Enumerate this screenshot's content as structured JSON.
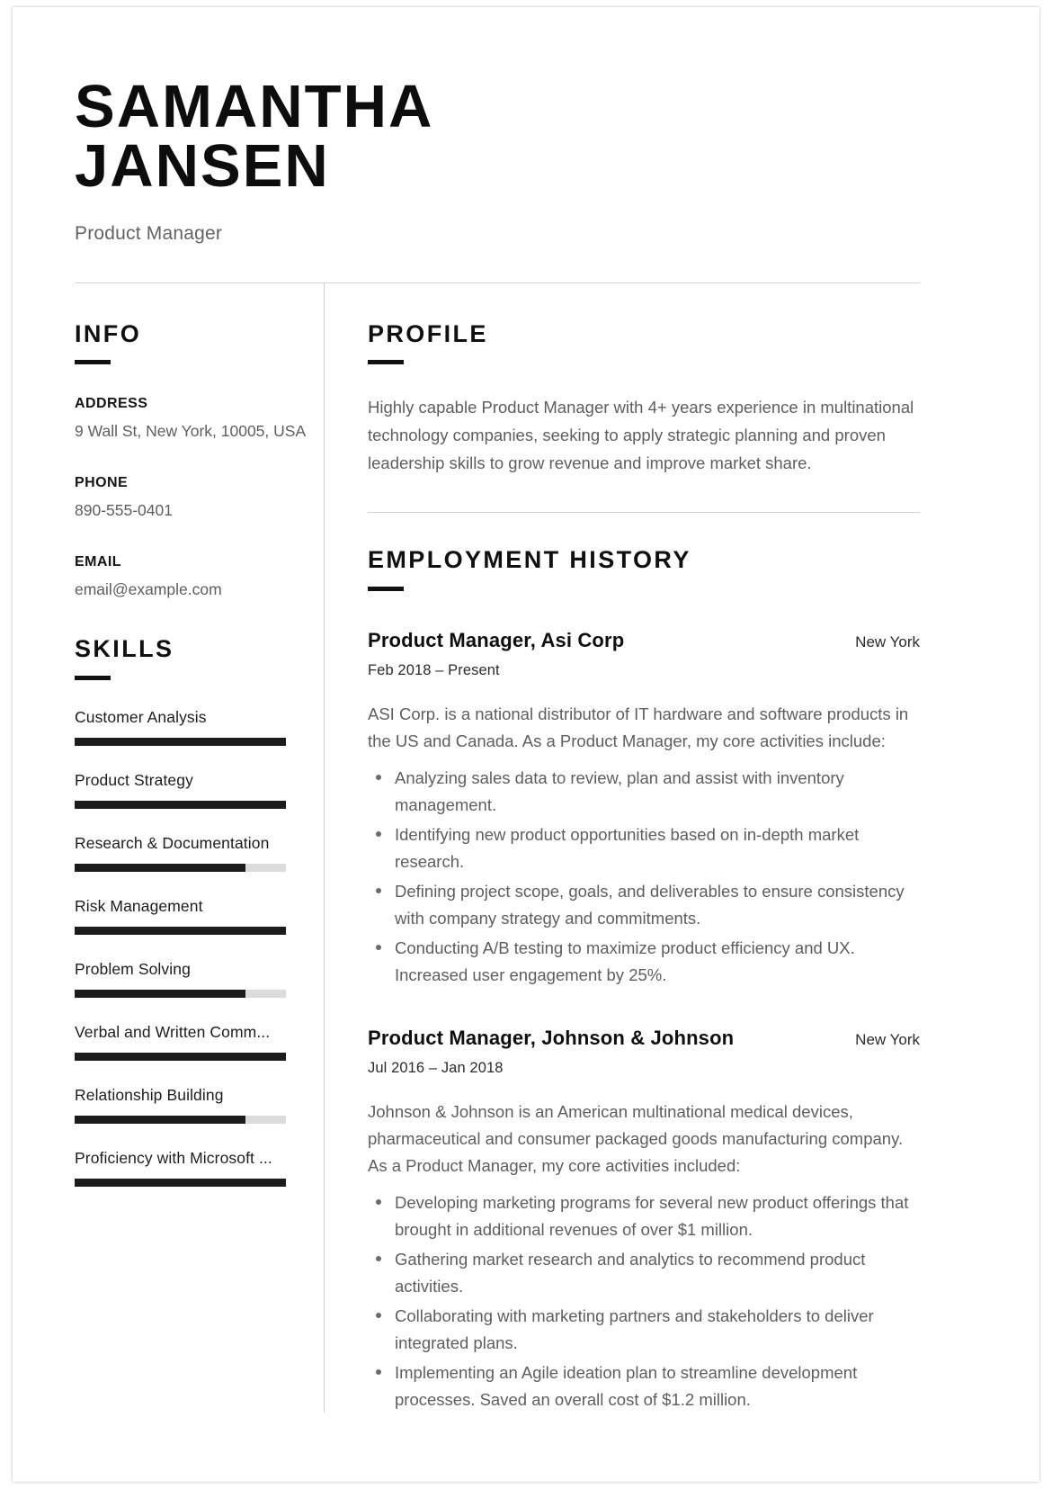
{
  "header": {
    "name_line1": "SAMANTHA",
    "name_line2": "JANSEN",
    "job_title": "Product Manager"
  },
  "info": {
    "section_title": "INFO",
    "fields": [
      {
        "label": "ADDRESS",
        "value": "9 Wall St, New York, 10005, USA"
      },
      {
        "label": "PHONE",
        "value": "890-555-0401"
      },
      {
        "label": "EMAIL",
        "value": "email@example.com"
      }
    ]
  },
  "skills": {
    "section_title": "SKILLS",
    "items": [
      {
        "name": "Customer Analysis",
        "level": 100
      },
      {
        "name": "Product Strategy",
        "level": 100
      },
      {
        "name": "Research & Documentation",
        "level": 81
      },
      {
        "name": "Risk Management",
        "level": 100
      },
      {
        "name": "Problem Solving",
        "level": 81
      },
      {
        "name": "Verbal and Written Comm...",
        "level": 100
      },
      {
        "name": "Relationship Building",
        "level": 81
      },
      {
        "name": "Proficiency with Microsoft ...",
        "level": 100
      }
    ]
  },
  "profile": {
    "section_title": "PROFILE",
    "text": "Highly capable Product Manager with 4+ years experience in multinational technology companies, seeking to apply strategic planning and proven leadership skills to grow revenue and improve market share."
  },
  "employment": {
    "section_title": "EMPLOYMENT HISTORY",
    "jobs": [
      {
        "role": "Product Manager, Asi Corp",
        "location": "New York",
        "dates": "Feb 2018 – Present",
        "description": "ASI Corp. is a national distributor of IT hardware and software products in the US and Canada. As a Product Manager, my core activities include:",
        "bullets": [
          "Analyzing sales data to review, plan and assist with inventory management.",
          "Identifying new product opportunities based on in-depth market research.",
          "Defining project scope, goals, and deliverables to ensure consistency with company strategy and commitments.",
          "Conducting A/B testing to maximize product efficiency and UX. Increased user engagement by 25%."
        ]
      },
      {
        "role": "Product Manager, Johnson & Johnson",
        "location": "New York",
        "dates": "Jul 2016 – Jan 2018",
        "description": "Johnson & Johnson is an American multinational medical devices, pharmaceutical and consumer packaged goods manufacturing company. As a Product Manager, my core activities included:",
        "bullets": [
          "Developing marketing programs for several new product offerings that brought in additional revenues of over $1 million.",
          "Gathering market research and analytics to recommend product activities.",
          "Collaborating with marketing partners and stakeholders to deliver integrated plans.",
          "Implementing an Agile ideation plan to streamline development processes. Saved an overall cost of $1.2 million."
        ]
      }
    ]
  },
  "colors": {
    "accent": "#111111",
    "body_text": "#5e5e5e",
    "heading_text": "#0f0f0f",
    "rule": "#d2d2d2",
    "bar_track": "#dcdcdc"
  }
}
